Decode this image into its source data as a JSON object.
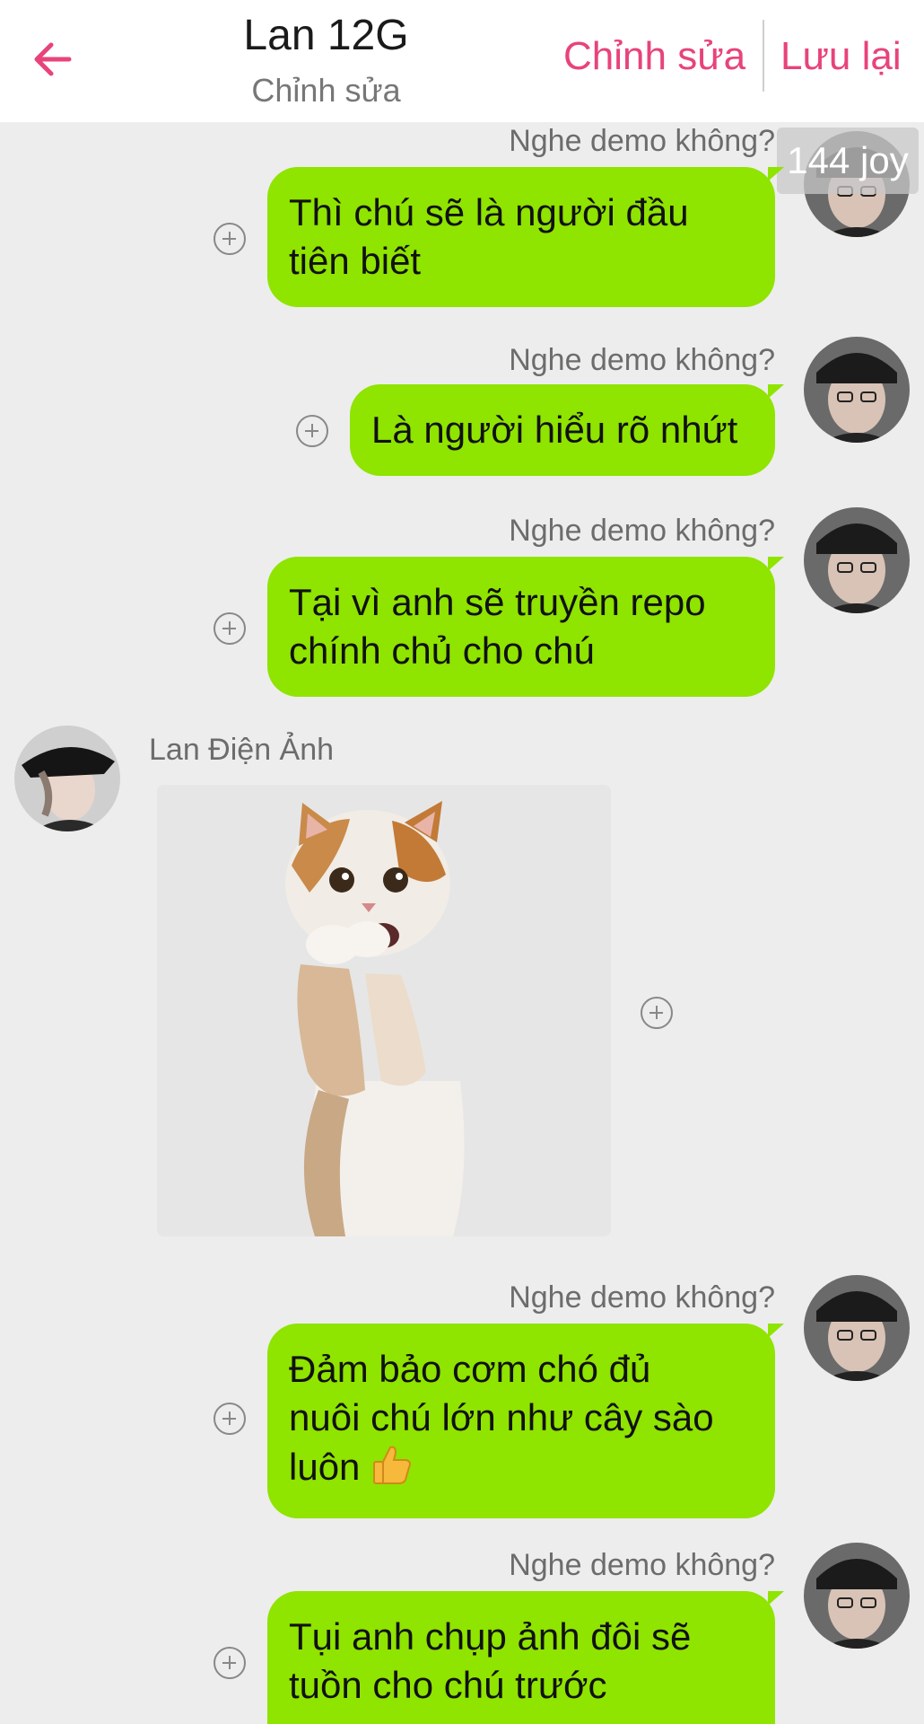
{
  "header": {
    "title": "Lan 12G",
    "subtitle": "Chỉnh sửa",
    "edit_label": "Chỉnh sửa",
    "save_label": "Lưu lại",
    "accent_color": "#e8437a"
  },
  "badge": {
    "text": "144 joy"
  },
  "messages": [
    {
      "side": "right",
      "sender": "Nghe demo không?",
      "lines": [
        "Thì chú sẽ là người đầu",
        "tiên biết"
      ]
    },
    {
      "side": "right",
      "sender": "Nghe demo không?",
      "lines": [
        "Là người hiểu rõ nhứt"
      ]
    },
    {
      "side": "right",
      "sender": "Nghe demo không?",
      "lines": [
        "Tại vì anh sẽ truyền repo",
        "chính chủ cho chú"
      ]
    },
    {
      "side": "left",
      "sender": "Lan Điện Ảnh",
      "type": "sticker",
      "sticker": "cat-praying"
    },
    {
      "side": "right",
      "sender": "Nghe demo không?",
      "lines": [
        "Đảm bảo cơm chó đủ",
        "nuôi chú lớn như cây sào",
        "luôn "
      ],
      "emoji": "thumbs-up"
    },
    {
      "side": "right",
      "sender": "Nghe demo không?",
      "lines": [
        "Tụi anh chụp ảnh đôi sẽ",
        "tuồn cho chú trước"
      ]
    }
  ],
  "colors": {
    "bubble": "#8fe400",
    "background": "#ededed"
  }
}
